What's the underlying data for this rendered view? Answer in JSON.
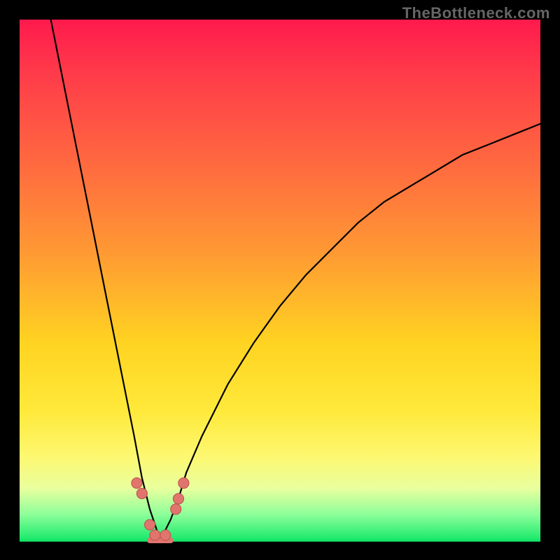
{
  "watermark": "TheBottleneck.com",
  "colors": {
    "gradient_top": "#ff1a4d",
    "gradient_bottom": "#18e86b",
    "curve": "#000000",
    "marker": "#e2746e",
    "floor": "#15e869"
  },
  "chart_data": {
    "type": "line",
    "title": "",
    "xlabel": "",
    "ylabel": "",
    "xlim": [
      0,
      100
    ],
    "ylim": [
      0,
      100
    ],
    "grid": false,
    "legend": false,
    "note": "V-shaped bottleneck curve; y = mismatch %, minimum ≈ 0 near x ≈ 27",
    "series": [
      {
        "name": "bottleneck_curve",
        "x": [
          6,
          8,
          10,
          12,
          14,
          16,
          18,
          20,
          22,
          23.5,
          25,
          27,
          29,
          30.5,
          32,
          35,
          40,
          45,
          50,
          55,
          60,
          65,
          70,
          75,
          80,
          85,
          90,
          95,
          100
        ],
        "y": [
          100,
          90,
          80,
          70,
          60,
          50,
          40,
          30,
          20,
          12,
          6,
          0,
          4,
          8,
          13,
          20,
          30,
          38,
          45,
          51,
          56,
          61,
          65,
          68,
          71,
          74,
          76,
          78,
          80
        ]
      }
    ],
    "markers": [
      {
        "x": 22.5,
        "y": 11
      },
      {
        "x": 23.5,
        "y": 9
      },
      {
        "x": 25,
        "y": 3
      },
      {
        "x": 26,
        "y": 1
      },
      {
        "x": 28,
        "y": 1
      },
      {
        "x": 30,
        "y": 6
      },
      {
        "x": 30.5,
        "y": 8
      },
      {
        "x": 31.5,
        "y": 11
      }
    ],
    "flat_segment": {
      "x0": 25,
      "x1": 29,
      "y": 0
    }
  }
}
